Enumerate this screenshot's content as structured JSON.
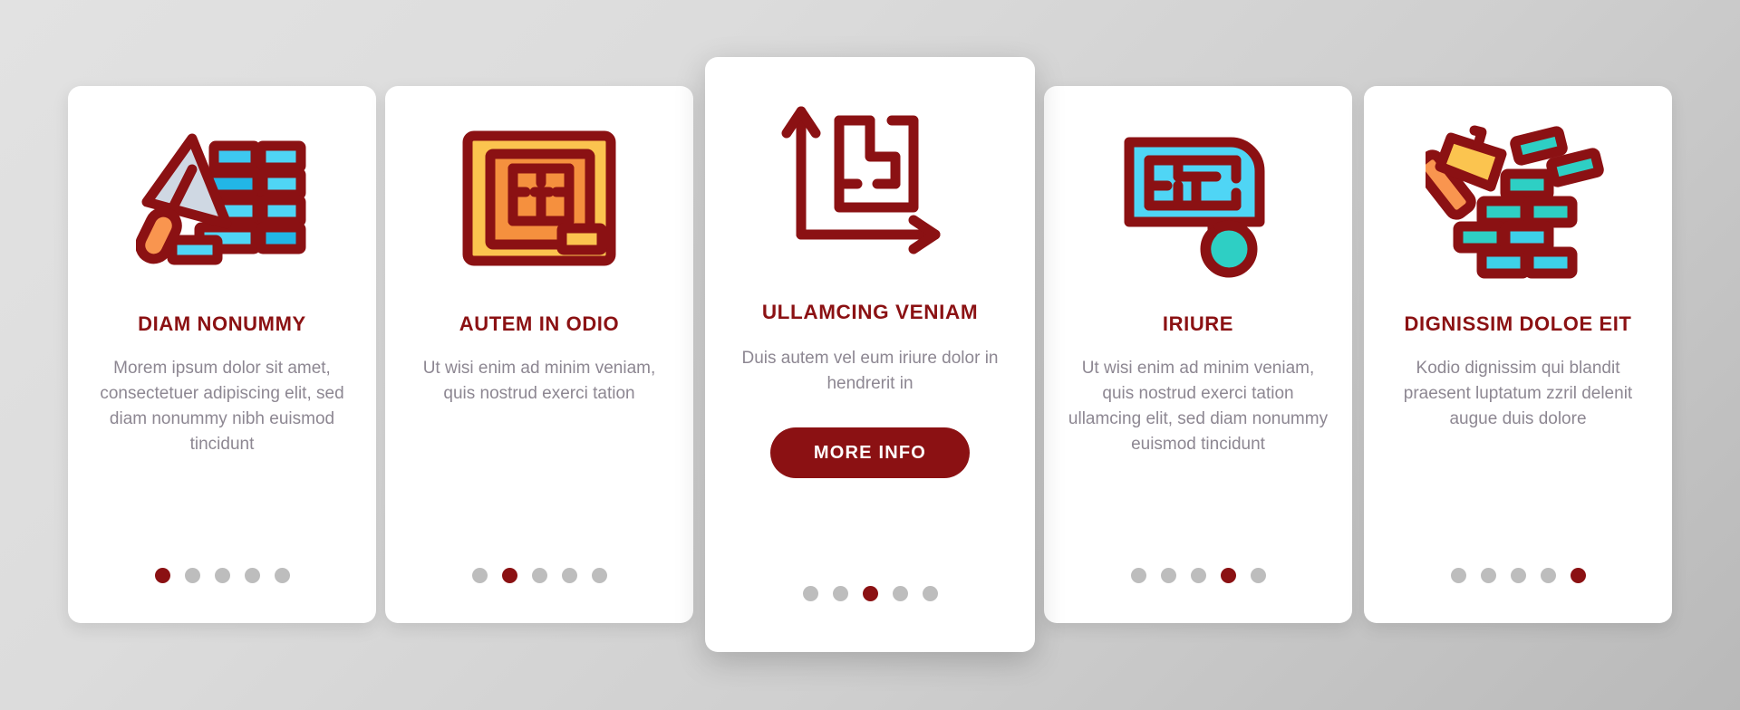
{
  "theme": {
    "accent": "#8b1113",
    "card_bg": "#ffffff",
    "body_text": "#8d8792",
    "dot_inactive": "#bdbdbd",
    "background": "#d5d5d5"
  },
  "cards": [
    {
      "icon": "trowel-bricks-icon",
      "title": "DIAM NONUMMY",
      "body": "Morem ipsum dolor sit amet, consectetuer adipiscing elit, sed diam nonummy nibh euismod tincidunt",
      "dots_total": 5,
      "dot_active": 1,
      "featured": false
    },
    {
      "icon": "framed-floor-plan-icon",
      "title": "AUTEM IN ODIO",
      "body": "Ut wisi enim ad minim veniam, quis nostrud exerci tation",
      "dots_total": 5,
      "dot_active": 2,
      "featured": false
    },
    {
      "icon": "floor-plan-axes-icon",
      "title": "ULLAMCING VENIAM",
      "body": "Duis autem vel eum iriure dolor in hendrerit in",
      "button_label": "MORE INFO",
      "dots_total": 5,
      "dot_active": 3,
      "featured": true
    },
    {
      "icon": "rolled-blueprint-icon",
      "title": "IRIURE",
      "body": "Ut wisi enim ad minim veniam, quis nostrud exerci tation ullamcing elit, sed diam nonummy euismod tincidunt",
      "dots_total": 5,
      "dot_active": 4,
      "featured": false
    },
    {
      "icon": "hammer-brick-wall-icon",
      "title": "DIGNISSIM DOLOE EIT",
      "body": "Kodio dignissim qui blandit praesent luptatum zzril delenit augue duis dolore",
      "dots_total": 5,
      "dot_active": 5,
      "featured": false
    }
  ]
}
